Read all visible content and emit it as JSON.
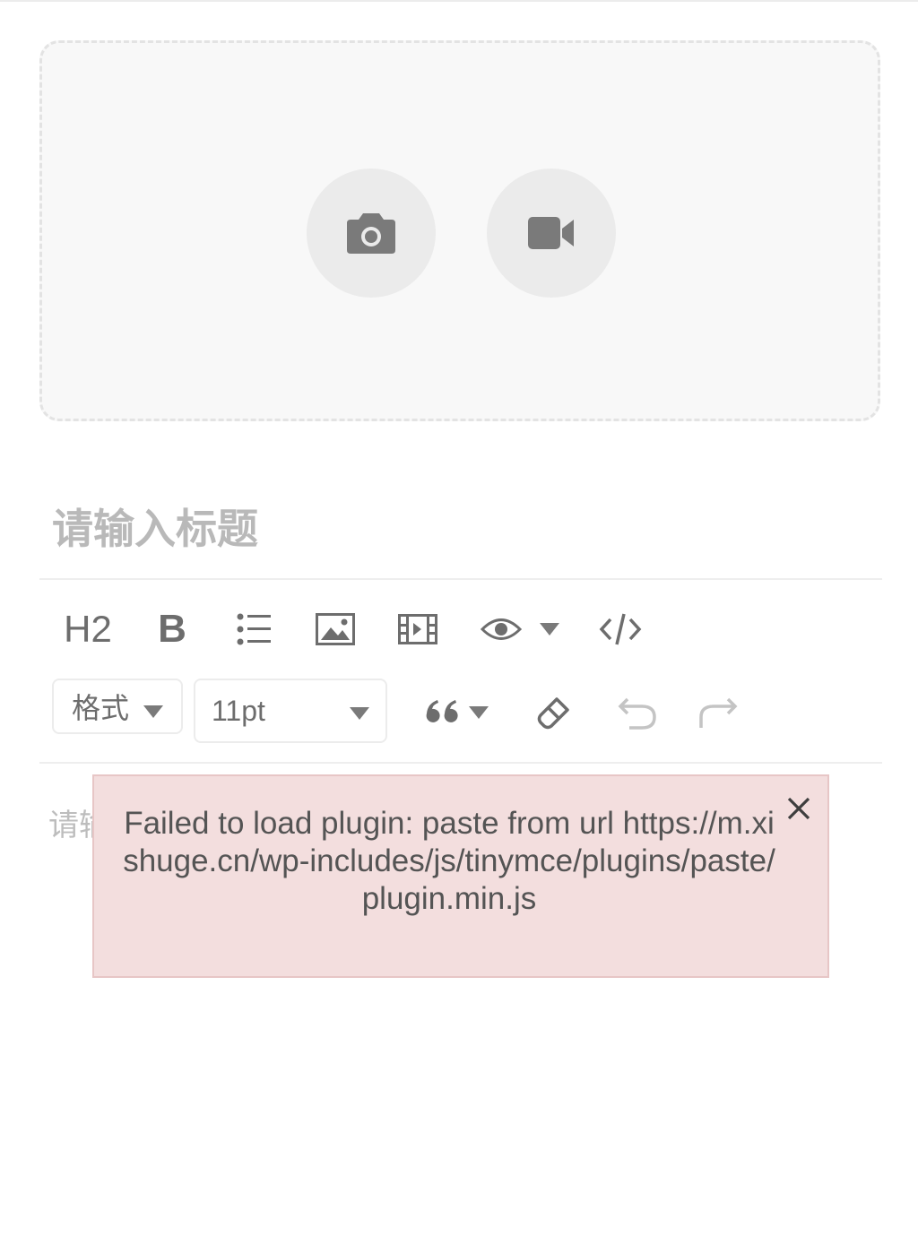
{
  "upload": {
    "photo_icon": "camera-icon",
    "video_icon": "video-camera-icon"
  },
  "title": {
    "placeholder": "请输入标题"
  },
  "toolbar": {
    "heading_label": "H2",
    "bold_label": "B",
    "format_label": "格式",
    "font_size_label": "11pt",
    "icons": [
      "bulleted-list-icon",
      "image-icon",
      "video-icon",
      "eye-icon",
      "code-icon",
      "quote-icon",
      "eraser-icon",
      "undo-icon",
      "redo-icon"
    ]
  },
  "editor": {
    "placeholder": "请输"
  },
  "notification": {
    "message": "Failed to load plugin: paste from url https://m.xishuge.cn/wp-includes/js/tinymce/plugins/paste/plugin.min.js",
    "close_icon": "close-icon"
  },
  "colors": {
    "notice_bg": "#f3dede",
    "icon_gray": "#6d6d6d",
    "upload_bg": "#f8f8f8"
  }
}
